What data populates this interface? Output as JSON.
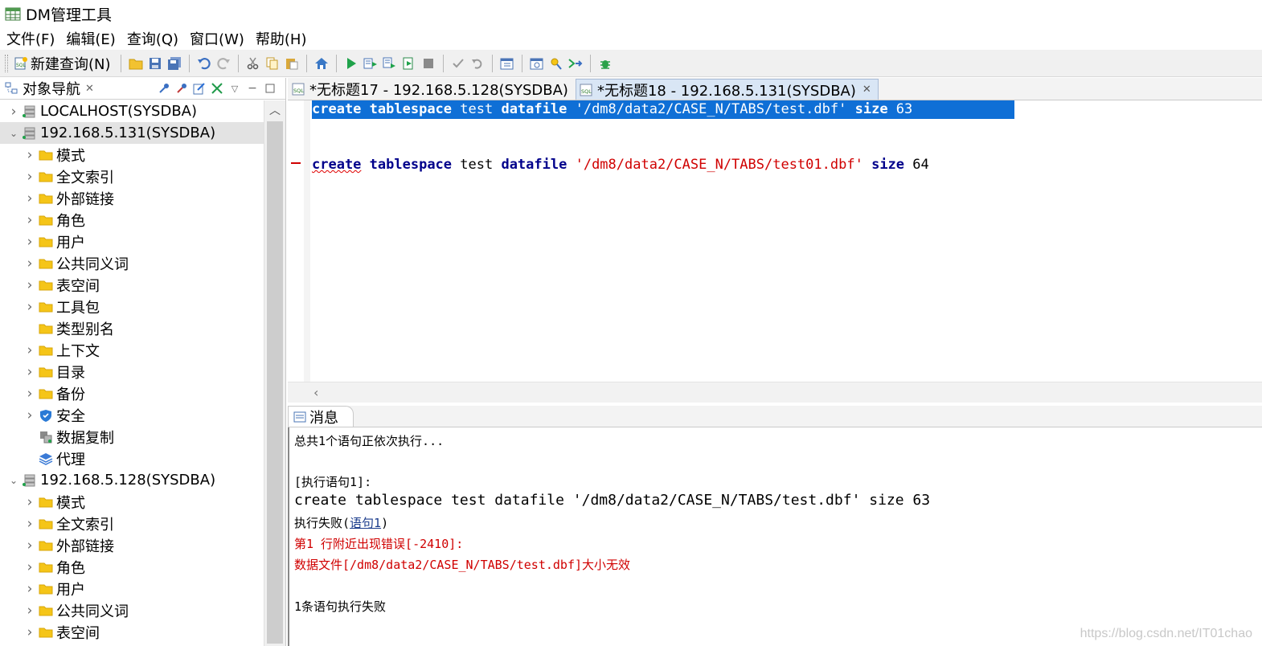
{
  "window": {
    "title": "DM管理工具"
  },
  "menu": [
    "文件(F)",
    "编辑(E)",
    "查询(Q)",
    "窗口(W)",
    "帮助(H)"
  ],
  "toolbar": {
    "new_query_label": "新建查询(N)"
  },
  "navigator": {
    "title": "对象导航",
    "tree": [
      {
        "label": "LOCALHOST(SYSDBA)",
        "level": 0,
        "expanded": false,
        "icon": "server-icon"
      },
      {
        "label": "192.168.5.131(SYSDBA)",
        "level": 0,
        "expanded": true,
        "selected": true,
        "icon": "server-icon"
      },
      {
        "label": "模式",
        "level": 1,
        "icon": "folder-icon"
      },
      {
        "label": "全文索引",
        "level": 1,
        "icon": "folder-icon"
      },
      {
        "label": "外部链接",
        "level": 1,
        "icon": "folder-icon"
      },
      {
        "label": "角色",
        "level": 1,
        "icon": "folder-icon"
      },
      {
        "label": "用户",
        "level": 1,
        "icon": "folder-icon"
      },
      {
        "label": "公共同义词",
        "level": 1,
        "icon": "folder-icon"
      },
      {
        "label": "表空间",
        "level": 1,
        "icon": "folder-icon"
      },
      {
        "label": "工具包",
        "level": 1,
        "icon": "folder-icon"
      },
      {
        "label": "类型别名",
        "level": 1,
        "icon": "folder-icon",
        "leaf": true
      },
      {
        "label": "上下文",
        "level": 1,
        "icon": "folder-icon"
      },
      {
        "label": "目录",
        "level": 1,
        "icon": "folder-icon"
      },
      {
        "label": "备份",
        "level": 1,
        "icon": "folder-icon"
      },
      {
        "label": "安全",
        "level": 1,
        "icon": "shield-icon"
      },
      {
        "label": "数据复制",
        "level": 1,
        "icon": "replication-icon",
        "leaf": true
      },
      {
        "label": "代理",
        "level": 1,
        "icon": "agent-icon",
        "leaf": true
      },
      {
        "label": "192.168.5.128(SYSDBA)",
        "level": 0,
        "expanded": true,
        "icon": "server-icon"
      },
      {
        "label": "模式",
        "level": 1,
        "icon": "folder-icon"
      },
      {
        "label": "全文索引",
        "level": 1,
        "icon": "folder-icon"
      },
      {
        "label": "外部链接",
        "level": 1,
        "icon": "folder-icon"
      },
      {
        "label": "角色",
        "level": 1,
        "icon": "folder-icon"
      },
      {
        "label": "用户",
        "level": 1,
        "icon": "folder-icon"
      },
      {
        "label": "公共同义词",
        "level": 1,
        "icon": "folder-icon"
      },
      {
        "label": "表空间",
        "level": 1,
        "icon": "folder-icon"
      }
    ]
  },
  "editor": {
    "tabs": [
      {
        "label": "*无标题17 - 192.168.5.128(SYSDBA)",
        "active": false
      },
      {
        "label": "*无标题18 - 192.168.5.131(SYSDBA)",
        "active": true
      }
    ],
    "lines": [
      {
        "parts": [
          [
            "kw",
            "create"
          ],
          [
            "pl",
            " "
          ],
          [
            "kw",
            "tablespace"
          ],
          [
            "pl",
            " test "
          ],
          [
            "kw",
            "datafile"
          ],
          [
            "pl",
            " "
          ],
          [
            "str",
            "'/dm8/data2/CASE_N/TABS/test.dbf'"
          ],
          [
            "pl",
            " "
          ],
          [
            "kw",
            "size"
          ],
          [
            "pl",
            " 63"
          ]
        ],
        "selected": true
      },
      {
        "parts": [],
        "selected": false
      },
      {
        "parts": [],
        "selected": false
      },
      {
        "parts": [
          [
            "kwerr",
            "create"
          ],
          [
            "pl",
            " "
          ],
          [
            "kw",
            "tablespace"
          ],
          [
            "pl",
            " test "
          ],
          [
            "kw",
            "datafile"
          ],
          [
            "pl",
            " "
          ],
          [
            "str",
            "'/dm8/data2/CASE_N/TABS/test01.dbf'"
          ],
          [
            "pl",
            " "
          ],
          [
            "kw",
            "size"
          ],
          [
            "pl",
            " 64"
          ]
        ],
        "selected": false
      }
    ]
  },
  "messages": {
    "tab_label": "消息",
    "summary": "总共1个语句正依次执行...",
    "exec_header": "[执行语句1]:",
    "statement": "create tablespace test datafile '/dm8/data2/CASE_N/TABS/test.dbf' size 63",
    "fail_prefix": "执行失败(",
    "fail_link": "语句1",
    "fail_suffix": ")",
    "error_line1": "第1 行附近出现错误[-2410]:",
    "error_line2": "数据文件[/dm8/data2/CASE_N/TABS/test.dbf]大小无效",
    "footer": "1条语句执行失败"
  },
  "watermark": "https://blog.csdn.net/IT01chao",
  "colors": {
    "keyword": "#00008b",
    "string": "#d00000",
    "selection": "#0f6fd6",
    "error": "#d00000",
    "folder": "#f5c518"
  }
}
